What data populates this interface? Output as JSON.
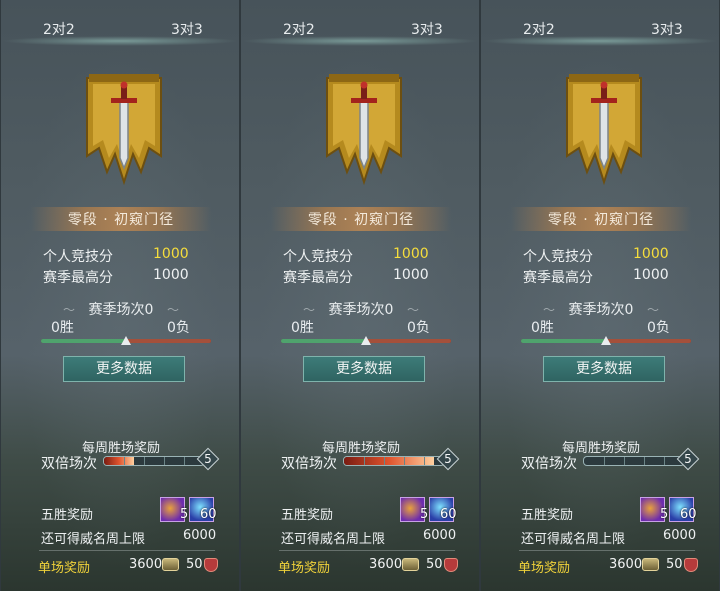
{
  "tabs": {
    "left": "2对2",
    "right": "3对3"
  },
  "panels": [
    {
      "rank": "零段 · 初窥门径",
      "personal_label": "个人竞技分",
      "personal_value": "1000",
      "season_high_label": "赛季最高分",
      "season_high_value": "1000",
      "season_matches": "赛季场次0",
      "wins": "0胜",
      "losses": "0负",
      "win_ratio": 0.5,
      "more_button": "更多数据",
      "weekly_title": "每周胜场奖励",
      "double_label": "双倍场次",
      "double_max": "5",
      "double_progress": 0.3,
      "five_win_label": "五胜奖励",
      "item1_count": "5",
      "item2_count": "60",
      "cap_label": "还可得威名周上限",
      "cap_value": "6000",
      "single_label": "单场奖励",
      "single_coins": "3600",
      "single_badges": "50"
    },
    {
      "rank": "零段 · 初窥门径",
      "personal_label": "个人竞技分",
      "personal_value": "1000",
      "season_high_label": "赛季最高分",
      "season_high_value": "1000",
      "season_matches": "赛季场次0",
      "wins": "0胜",
      "losses": "0负",
      "win_ratio": 0.5,
      "more_button": "更多数据",
      "weekly_title": "每周胜场奖励",
      "double_label": "双倍场次",
      "double_max": "5",
      "double_progress": 0.9,
      "five_win_label": "五胜奖励",
      "item1_count": "5",
      "item2_count": "60",
      "cap_label": "还可得威名周上限",
      "cap_value": "6000",
      "single_label": "单场奖励",
      "single_coins": "3600",
      "single_badges": "50"
    },
    {
      "rank": "零段 · 初窥门径",
      "personal_label": "个人竞技分",
      "personal_value": "1000",
      "season_high_label": "赛季最高分",
      "season_high_value": "1000",
      "season_matches": "赛季场次0",
      "wins": "0胜",
      "losses": "0负",
      "win_ratio": 0.5,
      "more_button": "更多数据",
      "weekly_title": "每周胜场奖励",
      "double_label": "双倍场次",
      "double_max": "5",
      "double_progress": 0,
      "five_win_label": "五胜奖励",
      "item1_count": "5",
      "item2_count": "60",
      "cap_label": "还可得威名周上限",
      "cap_value": "6000",
      "single_label": "单场奖励",
      "single_coins": "3600",
      "single_badges": "50"
    }
  ],
  "colors": {
    "gold_value": "#f6dd3c",
    "single_reward": "#f0d23a",
    "win_bar": "#4fa36d",
    "loss_bar": "#a4503b",
    "button": "#3d7b78"
  }
}
